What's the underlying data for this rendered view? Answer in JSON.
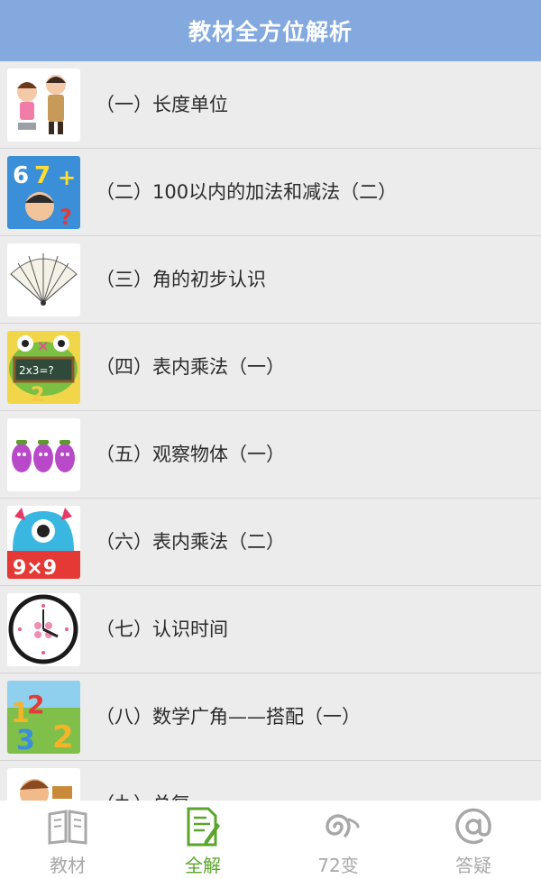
{
  "header": {
    "title": "教材全方位解析"
  },
  "list": {
    "items": [
      {
        "label": "（一）长度单位",
        "icon": "kids-measuring-icon"
      },
      {
        "label": "（二）100以内的加法和减法（二）",
        "icon": "numbers-boy-icon"
      },
      {
        "label": "（三）角的初步认识",
        "icon": "fan-icon"
      },
      {
        "label": "（四）表内乘法（一）",
        "icon": "frog-blackboard-icon"
      },
      {
        "label": "（五）观察物体（一）",
        "icon": "purple-figures-icon"
      },
      {
        "label": "（六）表内乘法（二）",
        "icon": "monster-9x9-icon"
      },
      {
        "label": "（七）认识时间",
        "icon": "clock-icon"
      },
      {
        "label": "（八）数学广角——搭配（一）",
        "icon": "number-characters-icon"
      },
      {
        "label": "（九）总复",
        "icon": "cartoon-man-icon"
      }
    ]
  },
  "tabbar": {
    "tabs": [
      {
        "label": "教材",
        "icon": "book-icon",
        "active": false
      },
      {
        "label": "全解",
        "icon": "document-pen-icon",
        "active": true
      },
      {
        "label": "72变",
        "icon": "swirl-icon",
        "active": false
      },
      {
        "label": "答疑",
        "icon": "at-icon",
        "active": false
      }
    ]
  },
  "colors": {
    "header_bg": "#84a9df",
    "active_tab": "#5aa52a",
    "inactive_tab": "#a8a8a8",
    "row_bg": "#ececec"
  }
}
